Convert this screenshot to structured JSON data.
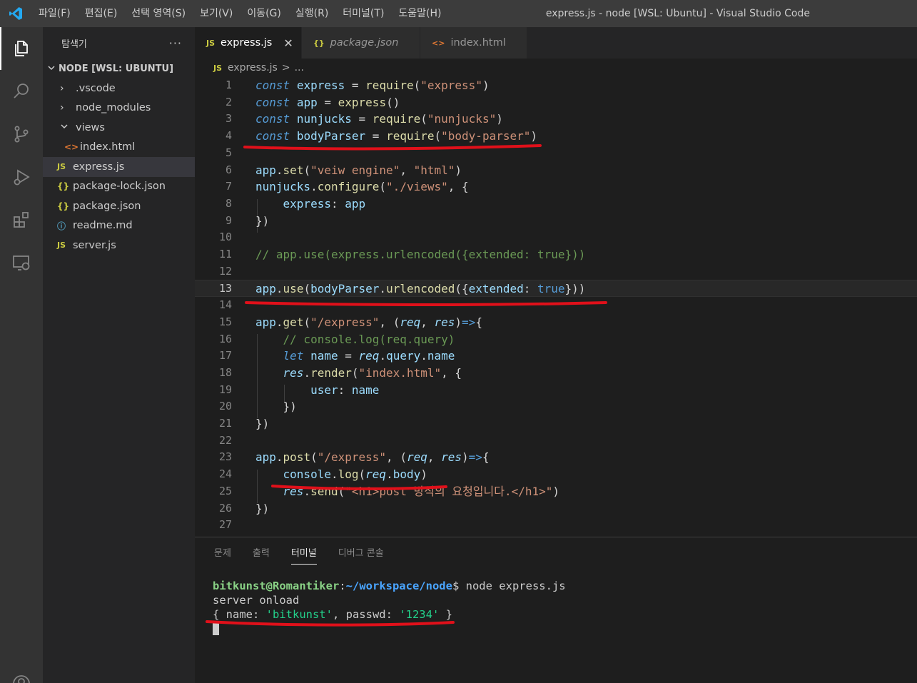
{
  "window": {
    "title": "express.js - node [WSL: Ubuntu] - Visual Studio Code",
    "menu": [
      "파일(F)",
      "편집(E)",
      "선택 영역(S)",
      "보기(V)",
      "이동(G)",
      "실행(R)",
      "터미널(T)",
      "도움말(H)"
    ]
  },
  "activity_bar": {
    "items": [
      "explorer-icon",
      "search-icon",
      "source-control-icon",
      "run-debug-icon",
      "extensions-icon",
      "remote-explorer-icon",
      "account-icon"
    ]
  },
  "sidebar": {
    "title": "탐색기",
    "more": "···",
    "section": "NODE [WSL: UBUNTU]",
    "items": [
      {
        "label": ".vscode",
        "icon": "chevron-right-icon"
      },
      {
        "label": "node_modules",
        "icon": "chevron-right-icon"
      },
      {
        "label": "views",
        "icon": "chevron-down-icon"
      },
      {
        "label": "index.html",
        "icon": "html-file-icon"
      },
      {
        "label": "express.js",
        "icon": "js-file-icon"
      },
      {
        "label": "package-lock.json",
        "icon": "json-file-icon"
      },
      {
        "label": "package.json",
        "icon": "json-file-icon"
      },
      {
        "label": "readme.md",
        "icon": "info-file-icon"
      },
      {
        "label": "server.js",
        "icon": "js-file-icon"
      }
    ]
  },
  "tabs": [
    {
      "label": "express.js",
      "icon": "JS",
      "active": true
    },
    {
      "label": "package.json",
      "icon": "{}",
      "active": false
    },
    {
      "label": "index.html",
      "icon": "<>",
      "active": false
    }
  ],
  "tab_close": "✕",
  "breadcrumb": {
    "file_icon": "JS",
    "file": "express.js",
    "sep": ">",
    "more": "..."
  },
  "editor": {
    "current_line": 13,
    "line_numbers": [
      "1",
      "2",
      "3",
      "4",
      "5",
      "6",
      "7",
      "8",
      "9",
      "10",
      "11",
      "12",
      "13",
      "14",
      "15",
      "16",
      "17",
      "18",
      "19",
      "20",
      "21",
      "22",
      "23",
      "24",
      "25",
      "26",
      "27"
    ]
  },
  "panel": {
    "tabs": [
      "문제",
      "출력",
      "터미널",
      "디버그 콘솔"
    ],
    "active_tab": "터미널",
    "terminal": {
      "user": "bitkunst@Romantiker",
      "path": "~/workspace/node",
      "command": "$ node express.js",
      "output_line1": "server onload",
      "obj_open": "{ name: ",
      "name_val": "'bitkunst'",
      "obj_mid": ", passwd: ",
      "passwd_val": "'1234'",
      "obj_close": " }"
    }
  },
  "colors": {
    "annotation": "#e0101a",
    "accent": "#0078d4"
  }
}
